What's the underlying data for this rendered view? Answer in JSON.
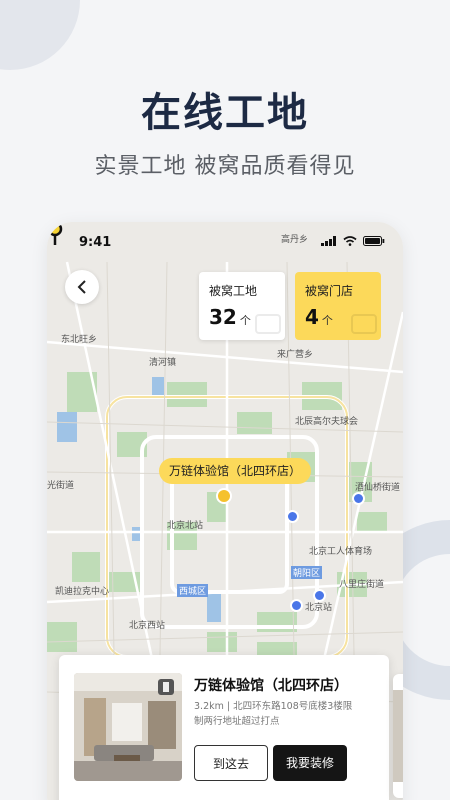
{
  "hero": {
    "title": "在线工地",
    "subtitle": "实景工地 被窝品质看得见"
  },
  "status_bar": {
    "time": "9:41"
  },
  "stats": {
    "sites_label": "被窝工地",
    "sites_count": "32",
    "sites_unit": "个",
    "stores_label": "被窝门店",
    "stores_count": "4",
    "stores_unit": "个"
  },
  "map": {
    "labels": {
      "top_road": "高丹乡",
      "dongbeiwang": "东北旺乡",
      "qinghe": "清河镇",
      "laiguang": "来广营乡",
      "golf": "北辰高尔夫球会",
      "jiuxianqiao": "酒仙桥街道",
      "guangjiedao": "光街道",
      "beijingbei": "北京北站",
      "gongti": "北京工人体育场",
      "chaoyang": "朝阳区",
      "xicheng": "西城区",
      "balizhuang": "八里庄街道",
      "kaidi": "凯迪拉克中心",
      "beijingzhan": "北京站",
      "beijingxi": "北京西站"
    },
    "store_tag": "万链体验馆（北四环店）"
  },
  "info_card": {
    "name": "万链体验馆（北四环店）",
    "description": "3.2km | 北四环东路108号底楼3楼限制两行地址超过打点",
    "go_button": "到这去",
    "renovate_button": "我要装修"
  }
}
